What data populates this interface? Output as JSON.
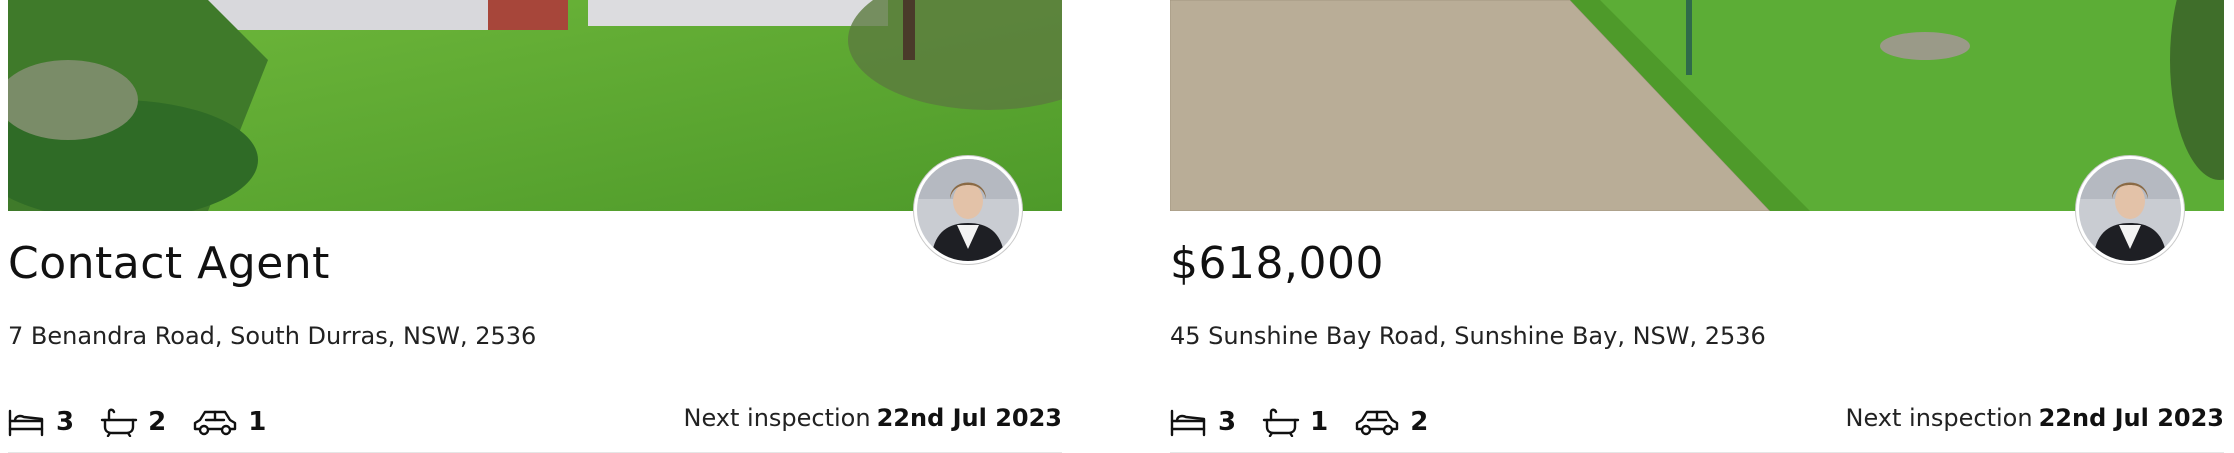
{
  "listings": [
    {
      "price": "Contact Agent",
      "address": "7 Benandra Road, South Durras, NSW, 2536",
      "beds": "3",
      "baths": "2",
      "cars": "1",
      "inspection_label": "Next inspection",
      "inspection_date": "22nd Jul 2023"
    },
    {
      "price": "$618,000",
      "address": "45 Sunshine Bay Road, Sunshine Bay, NSW, 2536",
      "beds": "3",
      "baths": "1",
      "cars": "2",
      "inspection_label": "Next inspection",
      "inspection_date": "22nd Jul 2023"
    }
  ],
  "icons": {
    "bed": "bed-icon",
    "bath": "bath-icon",
    "car": "car-icon"
  },
  "colors": {
    "grass": "#5aa832",
    "paving": "#b7ab95",
    "text": "#111111"
  }
}
